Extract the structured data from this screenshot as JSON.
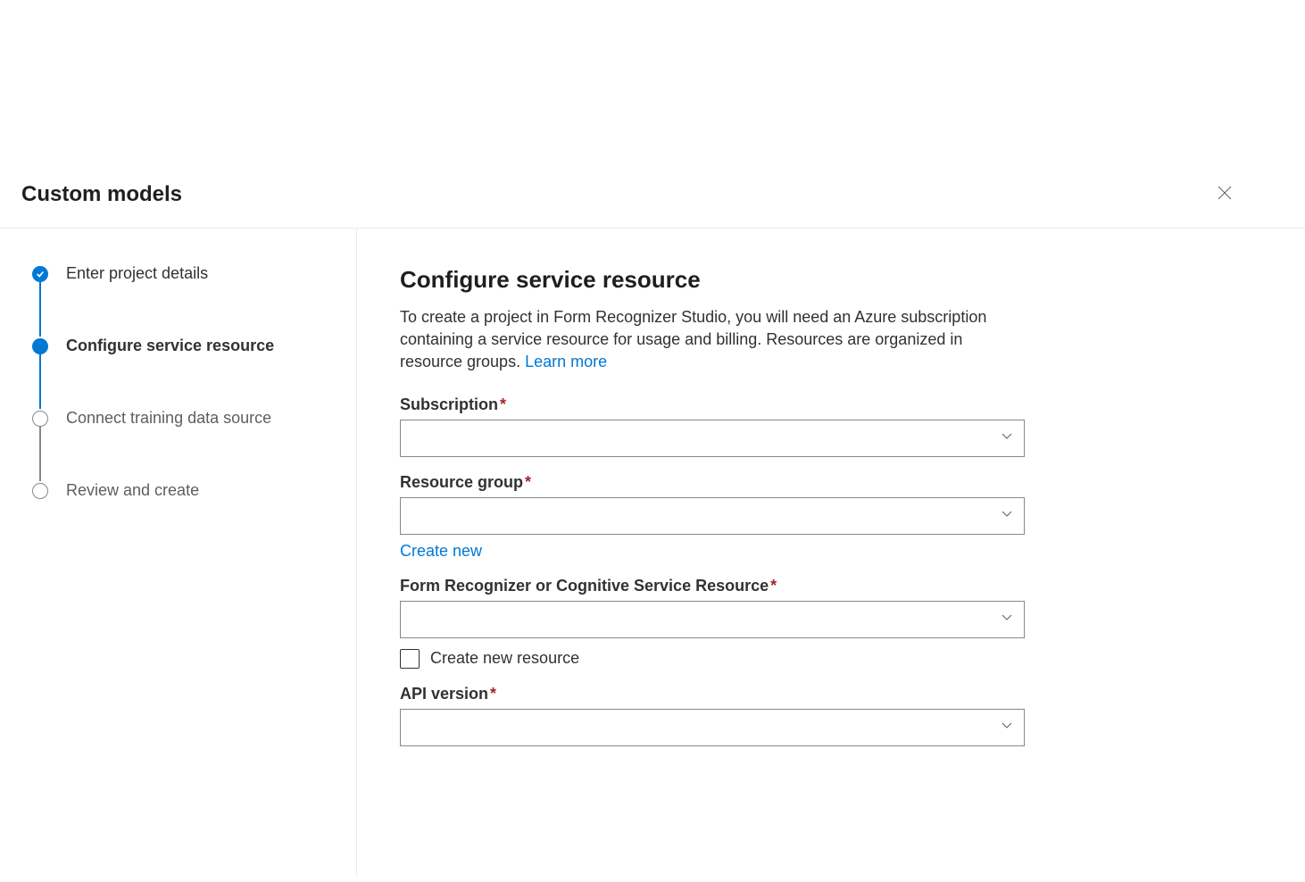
{
  "header": {
    "title": "Custom models"
  },
  "sidebar": {
    "steps": [
      {
        "label": "Enter project details",
        "state": "completed"
      },
      {
        "label": "Configure service resource",
        "state": "current"
      },
      {
        "label": "Connect training data source",
        "state": "pending"
      },
      {
        "label": "Review and create",
        "state": "pending"
      }
    ]
  },
  "main": {
    "title": "Configure service resource",
    "description": "To create a project in Form Recognizer Studio, you will need an Azure subscription containing a service resource for usage and billing. Resources are organized in resource groups. ",
    "learn_more": "Learn more",
    "fields": {
      "subscription": {
        "label": "Subscription",
        "required": true,
        "value": ""
      },
      "resource_group": {
        "label": "Resource group",
        "required": true,
        "value": "",
        "create_new": "Create new"
      },
      "form_recognizer": {
        "label": "Form Recognizer or Cognitive Service Resource",
        "required": true,
        "value": "",
        "checkbox_label": "Create new resource",
        "checkbox_checked": false
      },
      "api_version": {
        "label": "API version",
        "required": true,
        "value": ""
      }
    }
  }
}
